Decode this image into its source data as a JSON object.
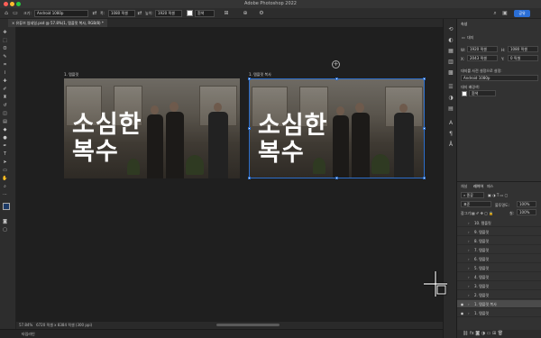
{
  "app": {
    "title": "Adobe Photoshop 2022"
  },
  "options": {
    "size_label": "크기:",
    "preset": "Android 1080p",
    "width_label": "폭:",
    "width": "1080 픽셀",
    "height_label": "높이:",
    "height": "1920 픽셀",
    "color_label": "흰색",
    "share_label": "공유"
  },
  "document": {
    "tab_title": "유튜브 썸네일.psd @ 57.8%(1, 탬플릿 복사, RGB/8) *"
  },
  "artboards": [
    {
      "label": "1. 탬플릿",
      "title_line1": "소심한",
      "title_line2": "복수"
    },
    {
      "label": "1. 템플릿 복사",
      "title_line1": "소심한",
      "title_line2": "복수"
    }
  ],
  "status": {
    "zoom": "57.84%",
    "info": "6720 픽셀 x 8384 픽셀 (300 ppi)"
  },
  "timeline": {
    "label": "타임라인"
  },
  "properties": {
    "title": "속성",
    "artboard_label": "대지",
    "w_label": "W:",
    "w_value": "1920 픽셀",
    "h_label": "H:",
    "h_value": "1080 픽셀",
    "x_label": "X:",
    "x_value": "2043 픽셀",
    "y_label": "Y:",
    "y_value": "0 픽셀",
    "preset_section": "대지를 사전 설정으로 설정:",
    "preset_value": "Android 1080p",
    "bg_section": "대지 배경색:",
    "bg_value": "흰색"
  },
  "layers_panel": {
    "tabs": [
      "채널",
      "레이어",
      "패스"
    ],
    "search_kind": "종류",
    "blend_mode": "표준",
    "opacity_label": "불투명도:",
    "opacity_value": "100%",
    "lock_label": "잠그기:",
    "fill_label": "칠:",
    "fill_value": "100%",
    "rows": [
      {
        "name": "10. 템플릿",
        "visible": false,
        "selected": false
      },
      {
        "name": "9. 템플릿",
        "visible": false,
        "selected": false
      },
      {
        "name": "8. 템플릿",
        "visible": false,
        "selected": false
      },
      {
        "name": "7. 템플릿",
        "visible": false,
        "selected": false
      },
      {
        "name": "6. 템플릿",
        "visible": false,
        "selected": false
      },
      {
        "name": "5. 템플릿",
        "visible": false,
        "selected": false
      },
      {
        "name": "4. 템플릿",
        "visible": false,
        "selected": false
      },
      {
        "name": "3. 템플릿",
        "visible": false,
        "selected": false
      },
      {
        "name": "2. 템플릿",
        "visible": false,
        "selected": false
      },
      {
        "name": "1. 템플릿 복사",
        "visible": true,
        "selected": true
      },
      {
        "name": "1. 템플릿",
        "visible": true,
        "selected": false
      }
    ]
  },
  "colors": {
    "foreground": "#1c3a66",
    "background": "#e02020",
    "accent": "#2b6fd6"
  }
}
